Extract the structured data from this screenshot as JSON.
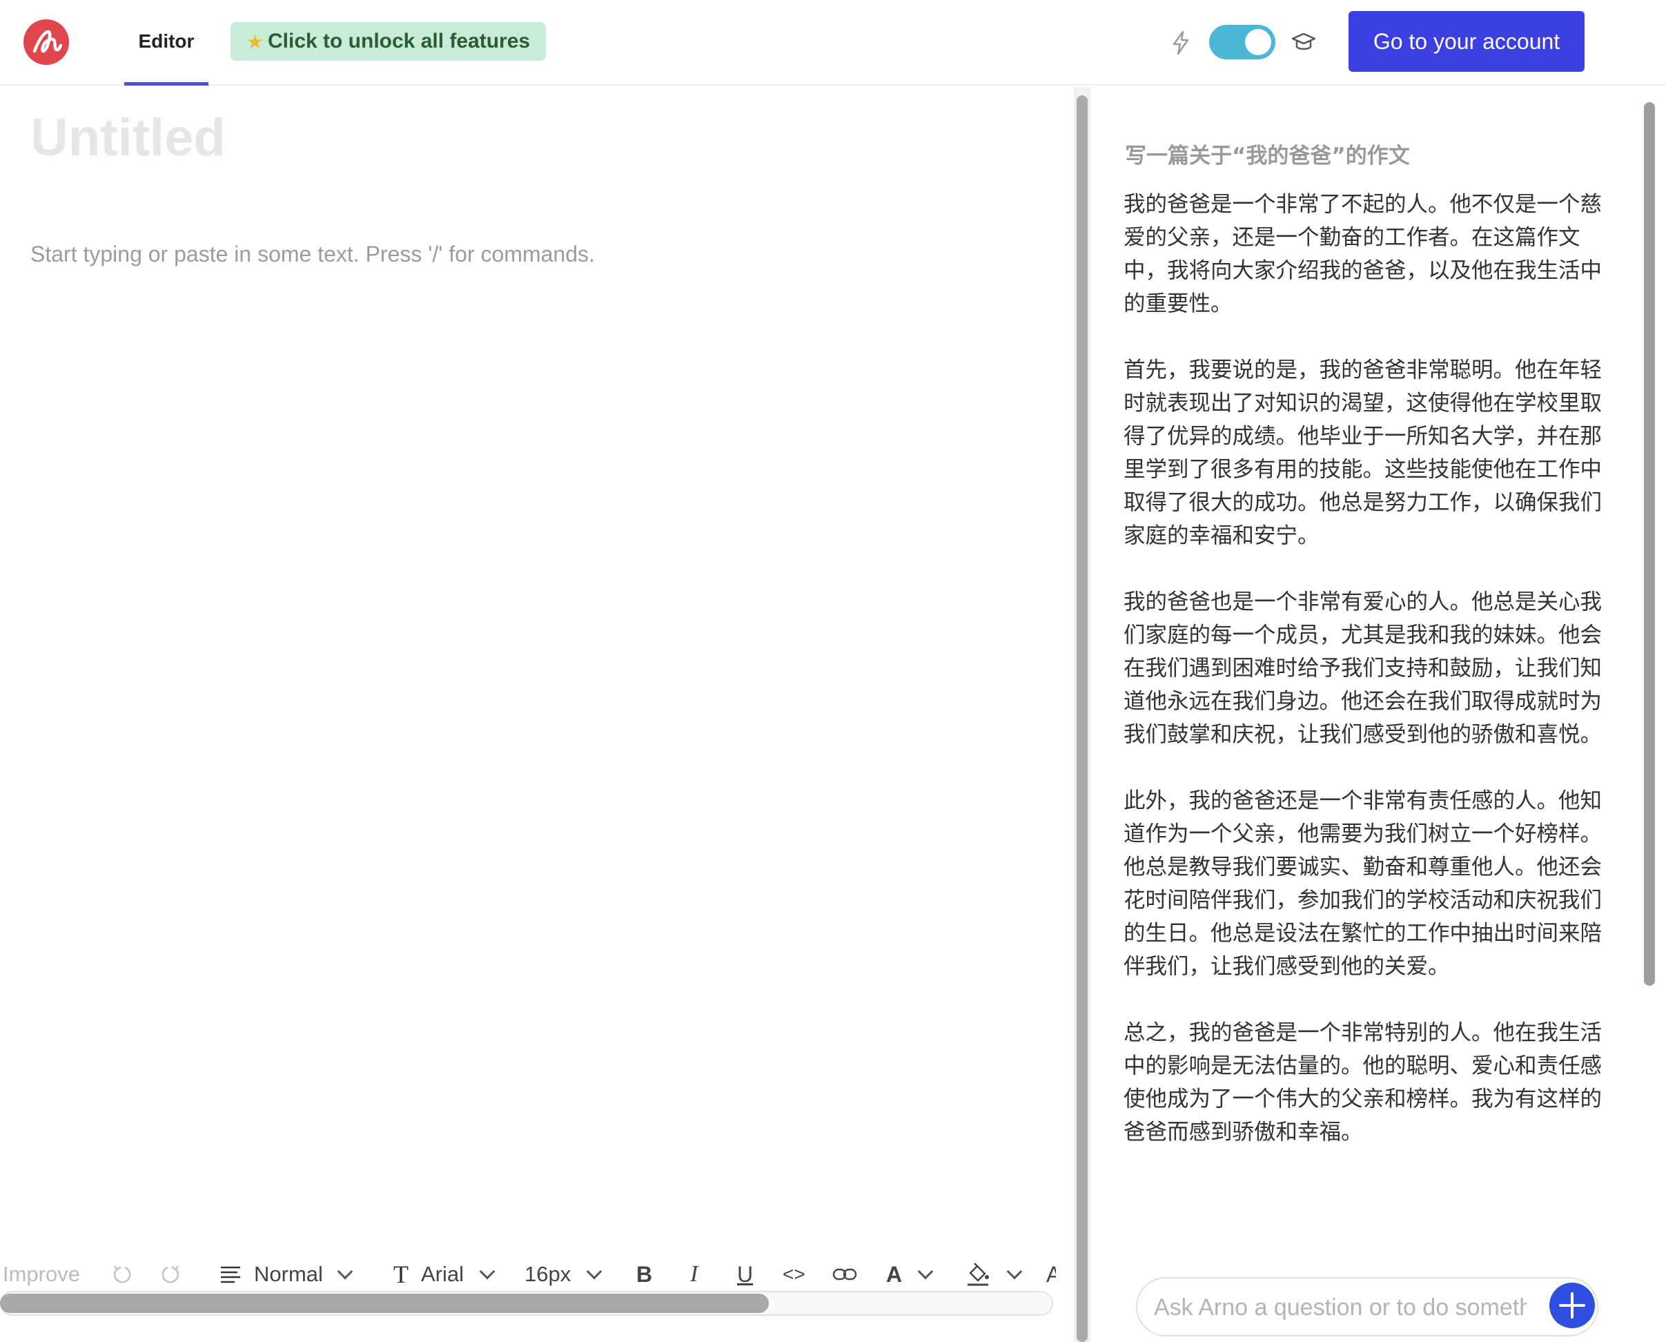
{
  "header": {
    "tab_editor": "Editor",
    "unlock_label": "Click to unlock all features",
    "account_button": "Go to your account",
    "toggle_on": true,
    "colors": {
      "accent": "#3d40e0",
      "toggle": "#4ab8d4",
      "logo": "#e0474c",
      "unlock_bg": "#c9ecd6"
    }
  },
  "editor": {
    "title_placeholder": "Untitled",
    "body_placeholder": "Start typing or paste in some text. Press '/' for commands.",
    "toolbar": {
      "improve": "Improve",
      "paragraph_style": "Normal",
      "font_family": "Arial",
      "font_size": "16px",
      "bold": "B",
      "italic": "I",
      "underline": "U",
      "code": "<>",
      "text_color": "A",
      "cut_off_glyph": "A"
    }
  },
  "assistant": {
    "prompt": "写一篇关于“我的爸爸”的作文",
    "paragraphs": [
      "我的爸爸是一个非常了不起的人。他不仅是一个慈爱的父亲，还是一个勤奋的工作者。在这篇作文中，我将向大家介绍我的爸爸，以及他在我生活中的重要性。",
      "首先，我要说的是，我的爸爸非常聪明。他在年轻时就表现出了对知识的渴望，这使得他在学校里取得了优异的成绩。他毕业于一所知名大学，并在那里学到了很多有用的技能。这些技能使他在工作中取得了很大的成功。他总是努力工作，以确保我们家庭的幸福和安宁。",
      "我的爸爸也是一个非常有爱心的人。他总是关心我们家庭的每一个成员，尤其是我和我的妹妹。他会在我们遇到困难时给予我们支持和鼓励，让我们知道他永远在我们身边。他还会在我们取得成就时为我们鼓掌和庆祝，让我们感受到他的骄傲和喜悦。",
      "此外，我的爸爸还是一个非常有责任感的人。他知道作为一个父亲，他需要为我们树立一个好榜样。他总是教导我们要诚实、勤奋和尊重他人。他还会花时间陪伴我们，参加我们的学校活动和庆祝我们的生日。他总是设法在繁忙的工作中抽出时间来陪伴我们，让我们感受到他的关爱。",
      "总之，我的爸爸是一个非常特别的人。他在我生活中的影响是无法估量的。他的聪明、爱心和责任感使他成为了一个伟大的父亲和榜样。我为有这样的爸爸而感到骄傲和幸福。"
    ],
    "ask_placeholder": "Ask Arno a question or to do something"
  }
}
